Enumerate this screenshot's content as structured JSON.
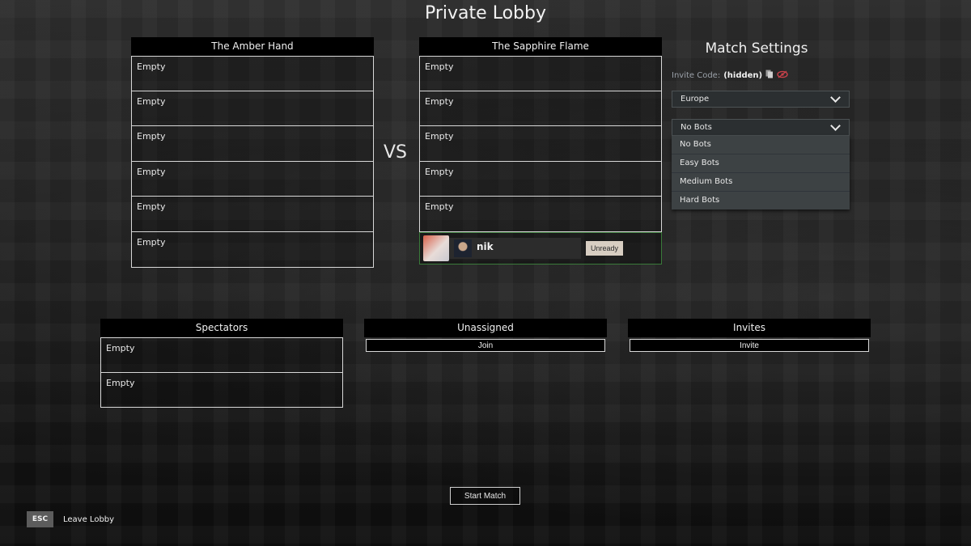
{
  "title": "Private Lobby",
  "vs_label": "VS",
  "teams": [
    {
      "name": "The Amber Hand",
      "slots": [
        "Empty",
        "Empty",
        "Empty",
        "Empty",
        "Empty",
        "Empty"
      ]
    },
    {
      "name": "The Sapphire Flame",
      "slots": [
        "Empty",
        "Empty",
        "Empty",
        "Empty",
        "Empty"
      ],
      "player": {
        "name": "nik",
        "hero_avatar": "hero-portrait",
        "user_avatar": "user-avatar",
        "ready_button": "Unready",
        "highlight_color": "#3a7a3a"
      }
    }
  ],
  "settings": {
    "title": "Match Settings",
    "invite_code_label": "Invite Code:",
    "invite_code_value": "(hidden)",
    "copy_icon": "copy-icon",
    "reveal_icon": "eye-icon",
    "region": "Europe",
    "bots": {
      "selected": "No Bots",
      "options": [
        "No Bots",
        "Easy Bots",
        "Medium Bots",
        "Hard Bots"
      ]
    }
  },
  "spectators": {
    "title": "Spectators",
    "slots": [
      "Empty",
      "Empty"
    ]
  },
  "unassigned": {
    "title": "Unassigned",
    "button": "Join"
  },
  "invites": {
    "title": "Invites",
    "button": "Invite"
  },
  "start_button": "Start Match",
  "leave": {
    "key": "ESC",
    "label": "Leave Lobby"
  }
}
